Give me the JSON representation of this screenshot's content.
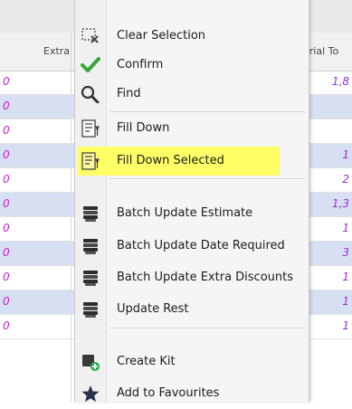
{
  "grid": {
    "columns": {
      "left": "Extra",
      "right": "erial To"
    },
    "rows": [
      {
        "left": "0",
        "right": "1,8"
      },
      {
        "left": "0",
        "right": ""
      },
      {
        "left": "0",
        "right": ""
      },
      {
        "left": "0",
        "right": "1"
      },
      {
        "left": "0",
        "right": "2"
      },
      {
        "left": "0",
        "right": "1,3"
      },
      {
        "left": "0",
        "right": "1"
      },
      {
        "left": "0",
        "right": "3"
      },
      {
        "left": "0",
        "right": "1"
      },
      {
        "left": "0",
        "right": "1"
      },
      {
        "left": "0",
        "right": "1"
      }
    ]
  },
  "menu": {
    "items": [
      {
        "label": "Clear Selection",
        "icon": "clear-selection-icon"
      },
      {
        "label": "Confirm",
        "icon": "checkmark-icon"
      },
      {
        "label": "Find",
        "icon": "magnifier-icon"
      },
      {
        "label": "Fill Down",
        "icon": "fill-down-icon"
      },
      {
        "label": "Fill Down Selected",
        "icon": "fill-down-selected-icon"
      },
      {
        "label": "Batch Update Estimate",
        "icon": "stack-icon"
      },
      {
        "label": "Batch Update Date Required",
        "icon": "stack-icon"
      },
      {
        "label": "Batch Update Extra Discounts",
        "icon": "stack-icon"
      },
      {
        "label": "Update Rest",
        "icon": "stack-icon"
      },
      {
        "label": "Create Kit",
        "icon": "create-kit-icon"
      },
      {
        "label": "Add to Favourites",
        "icon": "star-icon"
      }
    ],
    "highlight_color": "#ffff66"
  }
}
